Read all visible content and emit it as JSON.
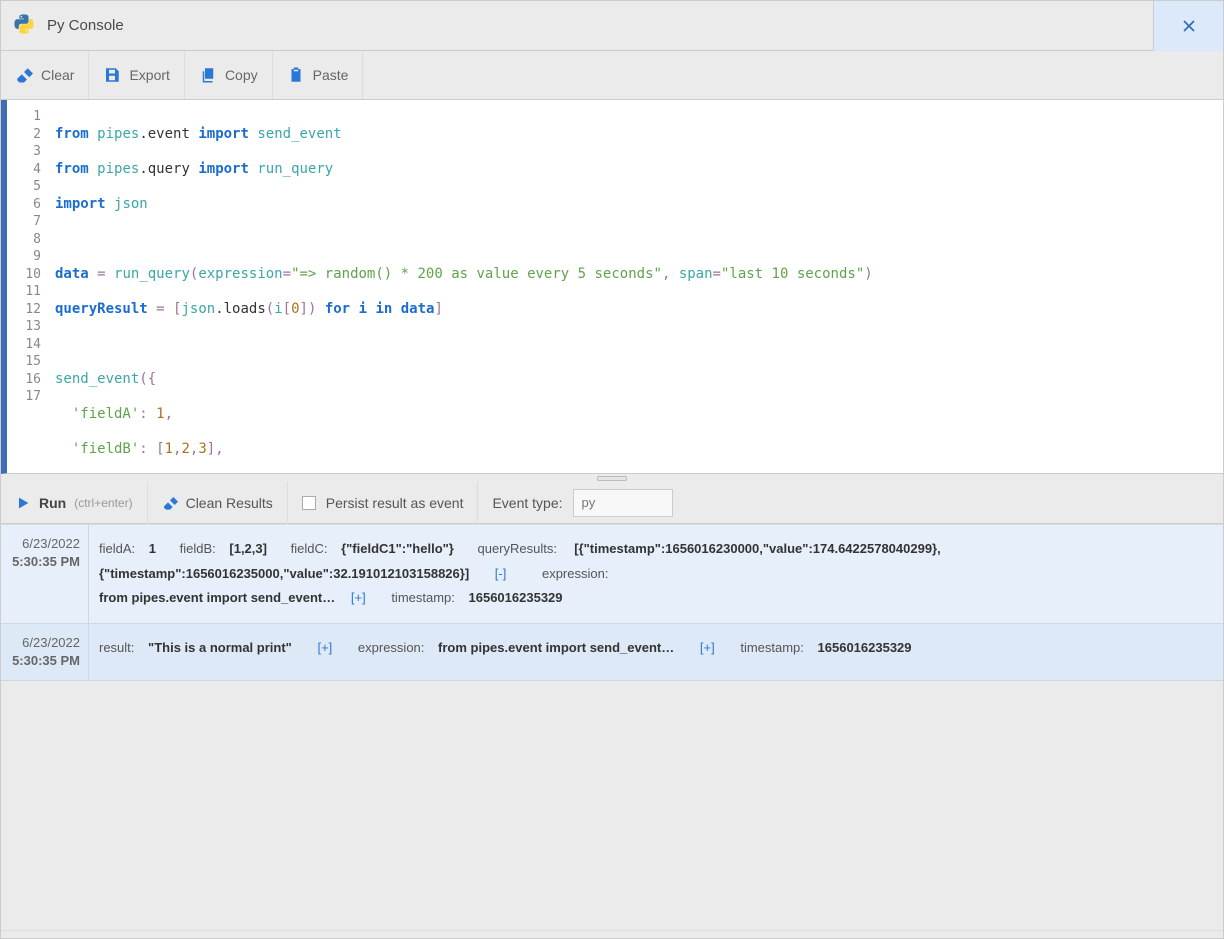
{
  "window": {
    "title": "Py Console"
  },
  "toolbar": {
    "clear": "Clear",
    "export": "Export",
    "copy": "Copy",
    "paste": "Paste"
  },
  "runbar": {
    "run": "Run",
    "run_hint": "(ctrl+enter)",
    "clean": "Clean Results",
    "persist": "Persist result as event",
    "event_type": "Event type:",
    "event_type_placeholder": "py"
  },
  "code": {
    "line_count": 17
  },
  "results": [
    {
      "date": "6/23/2022",
      "time": "5:30:35 PM",
      "fields": {
        "fieldA_label": "fieldA:",
        "fieldA_value": "1",
        "fieldB_label": "fieldB:",
        "fieldB_value": "[1,2,3]",
        "fieldC_label": "fieldC:",
        "fieldC_value": "{\"fieldC1\":\"hello\"}",
        "queryResults_label": "queryResults:",
        "queryResults_value": "[{\"timestamp\":1656016230000,\"value\":174.6422578040299},{\"timestamp\":1656016235000,\"value\":32.191012103158826}]",
        "collapse": "[-]",
        "expression_label": "expression:",
        "expression_value": "from pipes.event import send_event…",
        "expand1": "[+]",
        "timestamp_label": "timestamp:",
        "timestamp_value": "1656016235329"
      }
    },
    {
      "date": "6/23/2022",
      "time": "5:30:35 PM",
      "fields": {
        "result_label": "result:",
        "result_value": "\"This is a normal print\"",
        "expand1": "[+]",
        "expression_label": "expression:",
        "expression_value": "from pipes.event import send_event…",
        "expand2": "[+]",
        "timestamp_label": "timestamp:",
        "timestamp_value": "1656016235329"
      }
    }
  ]
}
